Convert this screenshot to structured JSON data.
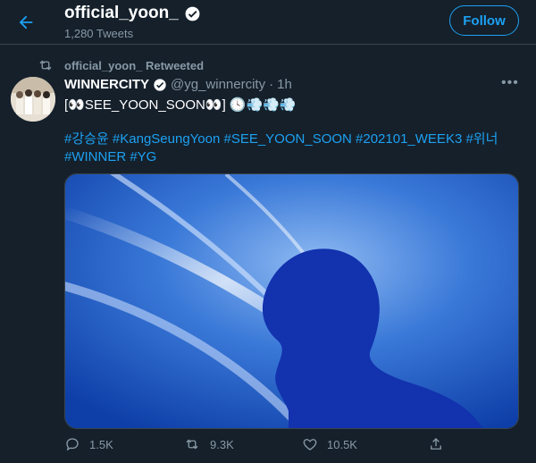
{
  "header": {
    "back_icon": "arrow-left-icon",
    "profile_name": "official_yoon_",
    "verified_icon": "verified-badge-icon",
    "tweet_count": "1,280 Tweets",
    "follow_label": "Follow",
    "accent_color": "#1da1f2"
  },
  "retweet_notice": {
    "icon": "retweet-icon",
    "text": "official_yoon_ Retweeted"
  },
  "tweet": {
    "author_name": "WINNERCITY",
    "author_handle": "@yg_winnercity",
    "separator": "·",
    "time": "1h",
    "more_icon": "more-icon",
    "text": "[👀SEE_YOON_SOON👀] 🕓💨💨💨",
    "hashtags_line1": "#강승윤 #KangSeungYoon #SEE_YOON_SOON #202101_WEEK3 #위너",
    "hashtags_line2": "#WINNER #YG",
    "media": {
      "type": "image",
      "description_icon": "silhouette-image"
    },
    "actions": {
      "reply_count": "1.5K",
      "retweet_count": "9.3K",
      "like_count": "10.5K",
      "reply_icon": "reply-icon",
      "retweet_icon": "retweet-icon",
      "like_icon": "heart-icon",
      "share_icon": "share-icon"
    }
  },
  "colors": {
    "background": "#15202b",
    "muted_text": "#8899a6",
    "divider": "#38444d"
  }
}
